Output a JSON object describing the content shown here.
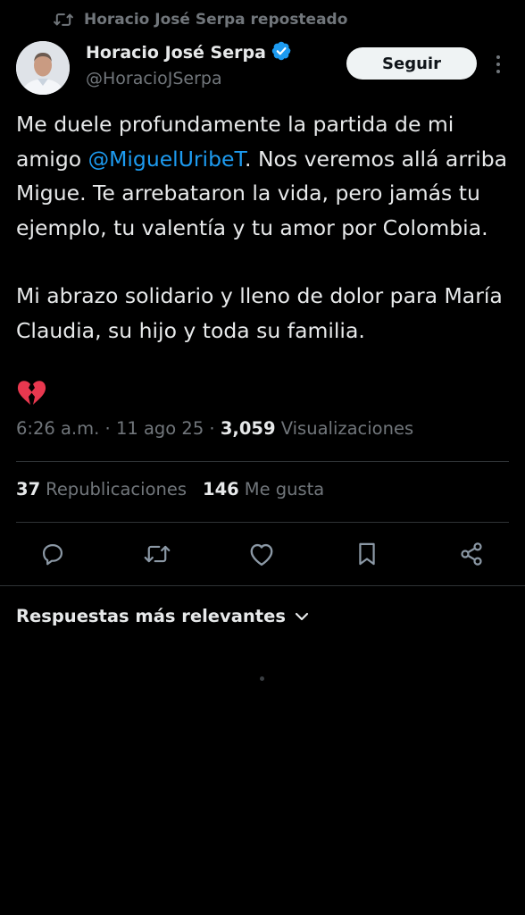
{
  "repost_banner": {
    "icon": "repost-icon",
    "text": "Horacio José Serpa reposteado"
  },
  "author": {
    "display_name": "Horacio José Serpa",
    "handle": "@HoracioJSerpa",
    "verified": true,
    "verified_color": "#1d9bf0"
  },
  "follow_button": {
    "label": "Seguir"
  },
  "tweet": {
    "paragraph1_before": "Me duele profundamente la partida de mi amigo ",
    "mention": "@MiguelUribeT",
    "paragraph1_after": ". Nos veremos allá arriba Migue. Te arrebataron la vida, pero jamás tu ejemplo, tu valentía y tu amor por Colombia.",
    "paragraph2": "Mi abrazo solidario y lleno de dolor para María Claudia, su hijo y toda su familia.",
    "emoji": "broken-heart-icon"
  },
  "meta": {
    "time": "6:26 a.m.",
    "sep1": " · ",
    "date": "11 ago 25",
    "sep2": " · ",
    "views_count": "3,059",
    "views_label": " Visualizaciones"
  },
  "stats": {
    "reposts_count": "37",
    "reposts_label": "Republicaciones",
    "likes_count": "146",
    "likes_label": "Me gusta"
  },
  "actions": [
    {
      "name": "reply",
      "icon": "reply-icon"
    },
    {
      "name": "repost",
      "icon": "repost-icon"
    },
    {
      "name": "like",
      "icon": "heart-icon"
    },
    {
      "name": "bookmark",
      "icon": "bookmark-icon"
    },
    {
      "name": "share",
      "icon": "share-icon"
    }
  ],
  "replies_sort": {
    "label": "Respuestas más relevantes",
    "icon": "chevron-down-icon"
  },
  "colors": {
    "background": "#000000",
    "text_primary": "#e7e9ea",
    "text_secondary": "#71767b",
    "accent": "#1d9bf0",
    "divider": "#2f3336",
    "emoji": "#e8384f"
  }
}
